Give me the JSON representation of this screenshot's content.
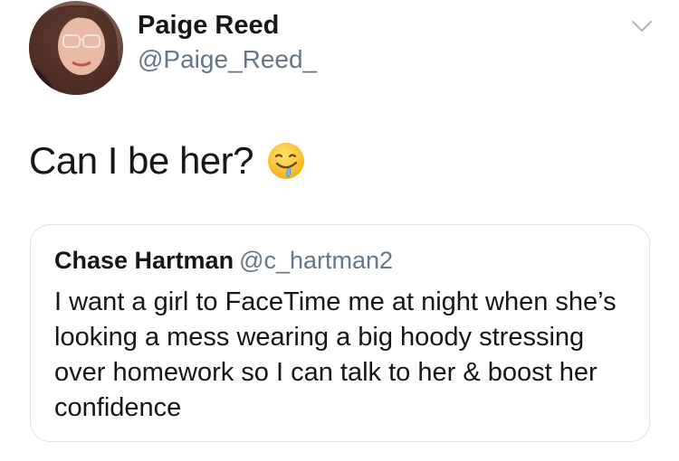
{
  "tweet": {
    "author_name": "Paige Reed",
    "author_handle": "@Paige_Reed_",
    "text": "Can I be her?",
    "emoji_icon": "drooling-face-emoji",
    "menu_icon": "chevron-down-icon"
  },
  "quoted_tweet": {
    "author_name": "Chase Hartman",
    "author_handle": "@c_hartman2",
    "text": "I want a girl to FaceTime me at night when she’s looking a mess wearing a big hoody stressing over homework so I can talk to her & boost her confidence"
  },
  "colors": {
    "primary_text": "#14171a",
    "secondary_text": "#657786",
    "border": "#dfe4e8"
  }
}
